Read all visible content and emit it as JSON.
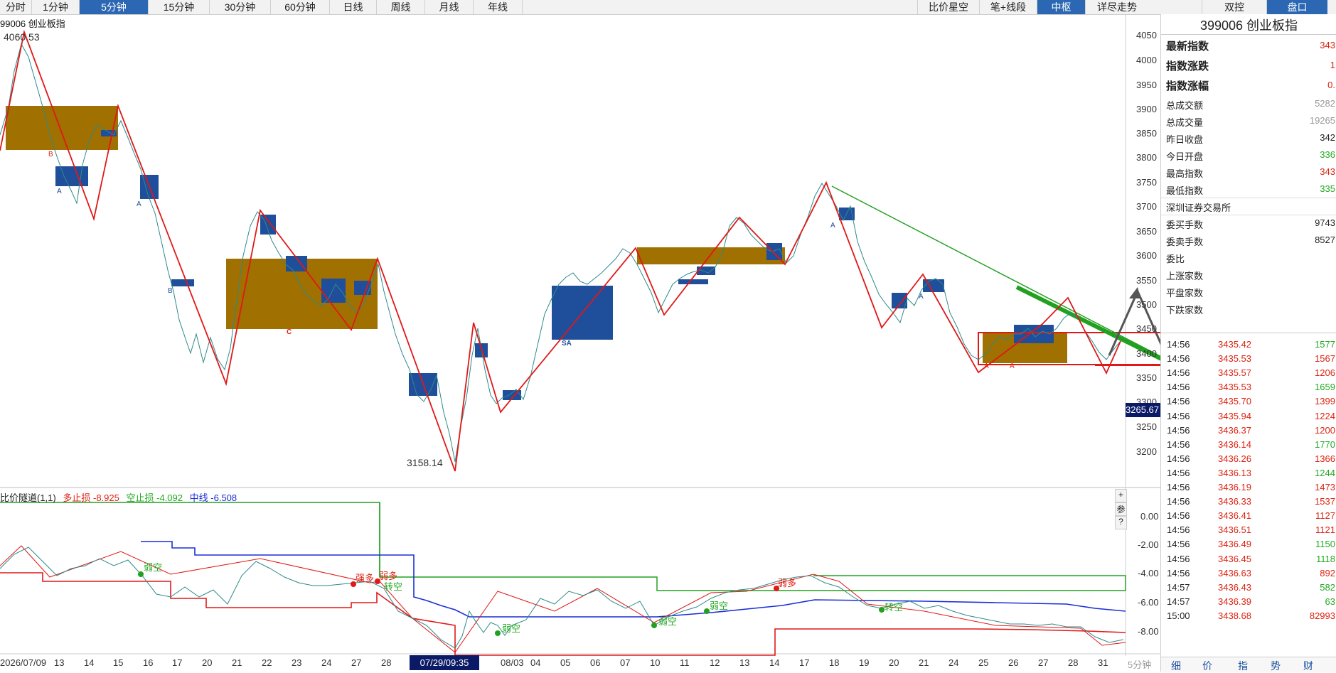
{
  "toolbar": {
    "left_tabs": [
      "分时",
      "1分钟",
      "5分钟",
      "15分钟",
      "30分钟",
      "60分钟",
      "日线",
      "周线",
      "月线",
      "年线"
    ],
    "active_left": "5分钟",
    "right_tabs": [
      "比价星空",
      "笔+线段",
      "中枢",
      "详尽走势",
      "双控",
      "盘口"
    ],
    "active_right": [
      "中枢",
      "盘口"
    ]
  },
  "chart": {
    "title": "99006 创业板指",
    "high_label": "4060.53",
    "low_label": "3158.14",
    "current_price_tag": "3265.67",
    "price_axis": [
      "4050",
      "4000",
      "3950",
      "3900",
      "3850",
      "3800",
      "3750",
      "3700",
      "3650",
      "3600",
      "3550",
      "3500",
      "3450",
      "3400",
      "3350",
      "3300",
      "3250",
      "3200"
    ],
    "markers": [
      "B",
      "A",
      "A",
      "B",
      "C",
      "SA",
      "A",
      "A",
      "A",
      "A"
    ]
  },
  "indicator": {
    "name": "比价隧道(1,1)",
    "long_stop_label": "多止损",
    "long_stop_value": "-8.925",
    "short_stop_label": "空止损",
    "short_stop_value": "-4.092",
    "mid_label": "中线",
    "mid_value": "-6.508",
    "axis": [
      "0.00",
      "-2.00",
      "-4.00",
      "-6.00",
      "-8.00"
    ],
    "annotations": [
      "弱空",
      "强多",
      "弱多",
      "转空",
      "弱空",
      "弱空",
      "弱空",
      "弱多",
      "转空"
    ],
    "side_controls": [
      "+",
      "参",
      "?"
    ]
  },
  "dates": {
    "labels": [
      "2026/07/09",
      "13",
      "14",
      "15",
      "16",
      "17",
      "20",
      "21",
      "22",
      "23",
      "24",
      "27",
      "28",
      "08/03",
      "04",
      "05",
      "06",
      "07",
      "10",
      "11",
      "12",
      "13",
      "14",
      "17",
      "18",
      "19",
      "20",
      "21",
      "24",
      "25",
      "26",
      "27",
      "28",
      "31"
    ],
    "highlight": "07/29/09:35",
    "period": "5分钟"
  },
  "side": {
    "title": "399006  创业板指",
    "rows_big": [
      {
        "label": "最新指数",
        "value": "343",
        "color": "#d21"
      },
      {
        "label": "指数涨跌",
        "value": "1",
        "color": "#d21"
      },
      {
        "label": "指数涨幅",
        "value": "0.",
        "color": "#d21"
      }
    ],
    "rows": [
      {
        "label": "总成交额",
        "value": "5282",
        "color": "#999"
      },
      {
        "label": "总成交量",
        "value": "19265",
        "color": "#999"
      },
      {
        "label": "昨日收盘",
        "value": "342",
        "color": "#222"
      },
      {
        "label": "今日开盘",
        "value": "336",
        "color": "#2a2"
      },
      {
        "label": "最高指数",
        "value": "343",
        "color": "#d21"
      },
      {
        "label": "最低指数",
        "value": "335",
        "color": "#2a2"
      }
    ],
    "exchange": "深圳证券交易所",
    "rows2": [
      {
        "label": "委买手数",
        "value": "9743",
        "color": "#222"
      },
      {
        "label": "委卖手数",
        "value": "8527",
        "color": "#222"
      },
      {
        "label": "委比",
        "value": "",
        "color": "#222"
      },
      {
        "label": "上涨家数",
        "value": "",
        "color": "#222"
      },
      {
        "label": "平盘家数",
        "value": "",
        "color": "#222"
      },
      {
        "label": "下跌家数",
        "value": "",
        "color": "#222"
      }
    ],
    "trades": [
      {
        "time": "14:56",
        "price": "3435.42",
        "vol": "1577",
        "vcolor": "#2a2"
      },
      {
        "time": "14:56",
        "price": "3435.53",
        "vol": "1567",
        "vcolor": "#d21"
      },
      {
        "time": "14:56",
        "price": "3435.57",
        "vol": "1206",
        "vcolor": "#d21"
      },
      {
        "time": "14:56",
        "price": "3435.53",
        "vol": "1659",
        "vcolor": "#2a2"
      },
      {
        "time": "14:56",
        "price": "3435.70",
        "vol": "1399",
        "vcolor": "#d21"
      },
      {
        "time": "14:56",
        "price": "3435.94",
        "vol": "1224",
        "vcolor": "#d21"
      },
      {
        "time": "14:56",
        "price": "3436.37",
        "vol": "1200",
        "vcolor": "#d21"
      },
      {
        "time": "14:56",
        "price": "3436.14",
        "vol": "1770",
        "vcolor": "#2a2"
      },
      {
        "time": "14:56",
        "price": "3436.26",
        "vol": "1366",
        "vcolor": "#d21"
      },
      {
        "time": "14:56",
        "price": "3436.13",
        "vol": "1244",
        "vcolor": "#2a2"
      },
      {
        "time": "14:56",
        "price": "3436.19",
        "vol": "1473",
        "vcolor": "#d21"
      },
      {
        "time": "14:56",
        "price": "3436.33",
        "vol": "1537",
        "vcolor": "#d21"
      },
      {
        "time": "14:56",
        "price": "3436.41",
        "vol": "1127",
        "vcolor": "#d21"
      },
      {
        "time": "14:56",
        "price": "3436.51",
        "vol": "1121",
        "vcolor": "#d21"
      },
      {
        "time": "14:56",
        "price": "3436.49",
        "vol": "1150",
        "vcolor": "#2a2"
      },
      {
        "time": "14:56",
        "price": "3436.45",
        "vol": "1118",
        "vcolor": "#2a2"
      },
      {
        "time": "14:56",
        "price": "3436.63",
        "vol": "892",
        "vcolor": "#d21"
      },
      {
        "time": "14:57",
        "price": "3436.43",
        "vol": "582",
        "vcolor": "#2a2"
      },
      {
        "time": "14:57",
        "price": "3436.39",
        "vol": "63",
        "vcolor": "#2a2"
      },
      {
        "time": "15:00",
        "price": "3438.68",
        "vol": "82993",
        "vcolor": "#d21"
      }
    ],
    "bottom_tabs": [
      "细",
      "价",
      "指",
      "势",
      "财"
    ]
  },
  "colors": {
    "accent": "#2b67b2",
    "zone_gold": "#a07000",
    "zone_blue": "#1f4e9a",
    "bi_red": "#e01818",
    "trend_green": "#22a020"
  }
}
